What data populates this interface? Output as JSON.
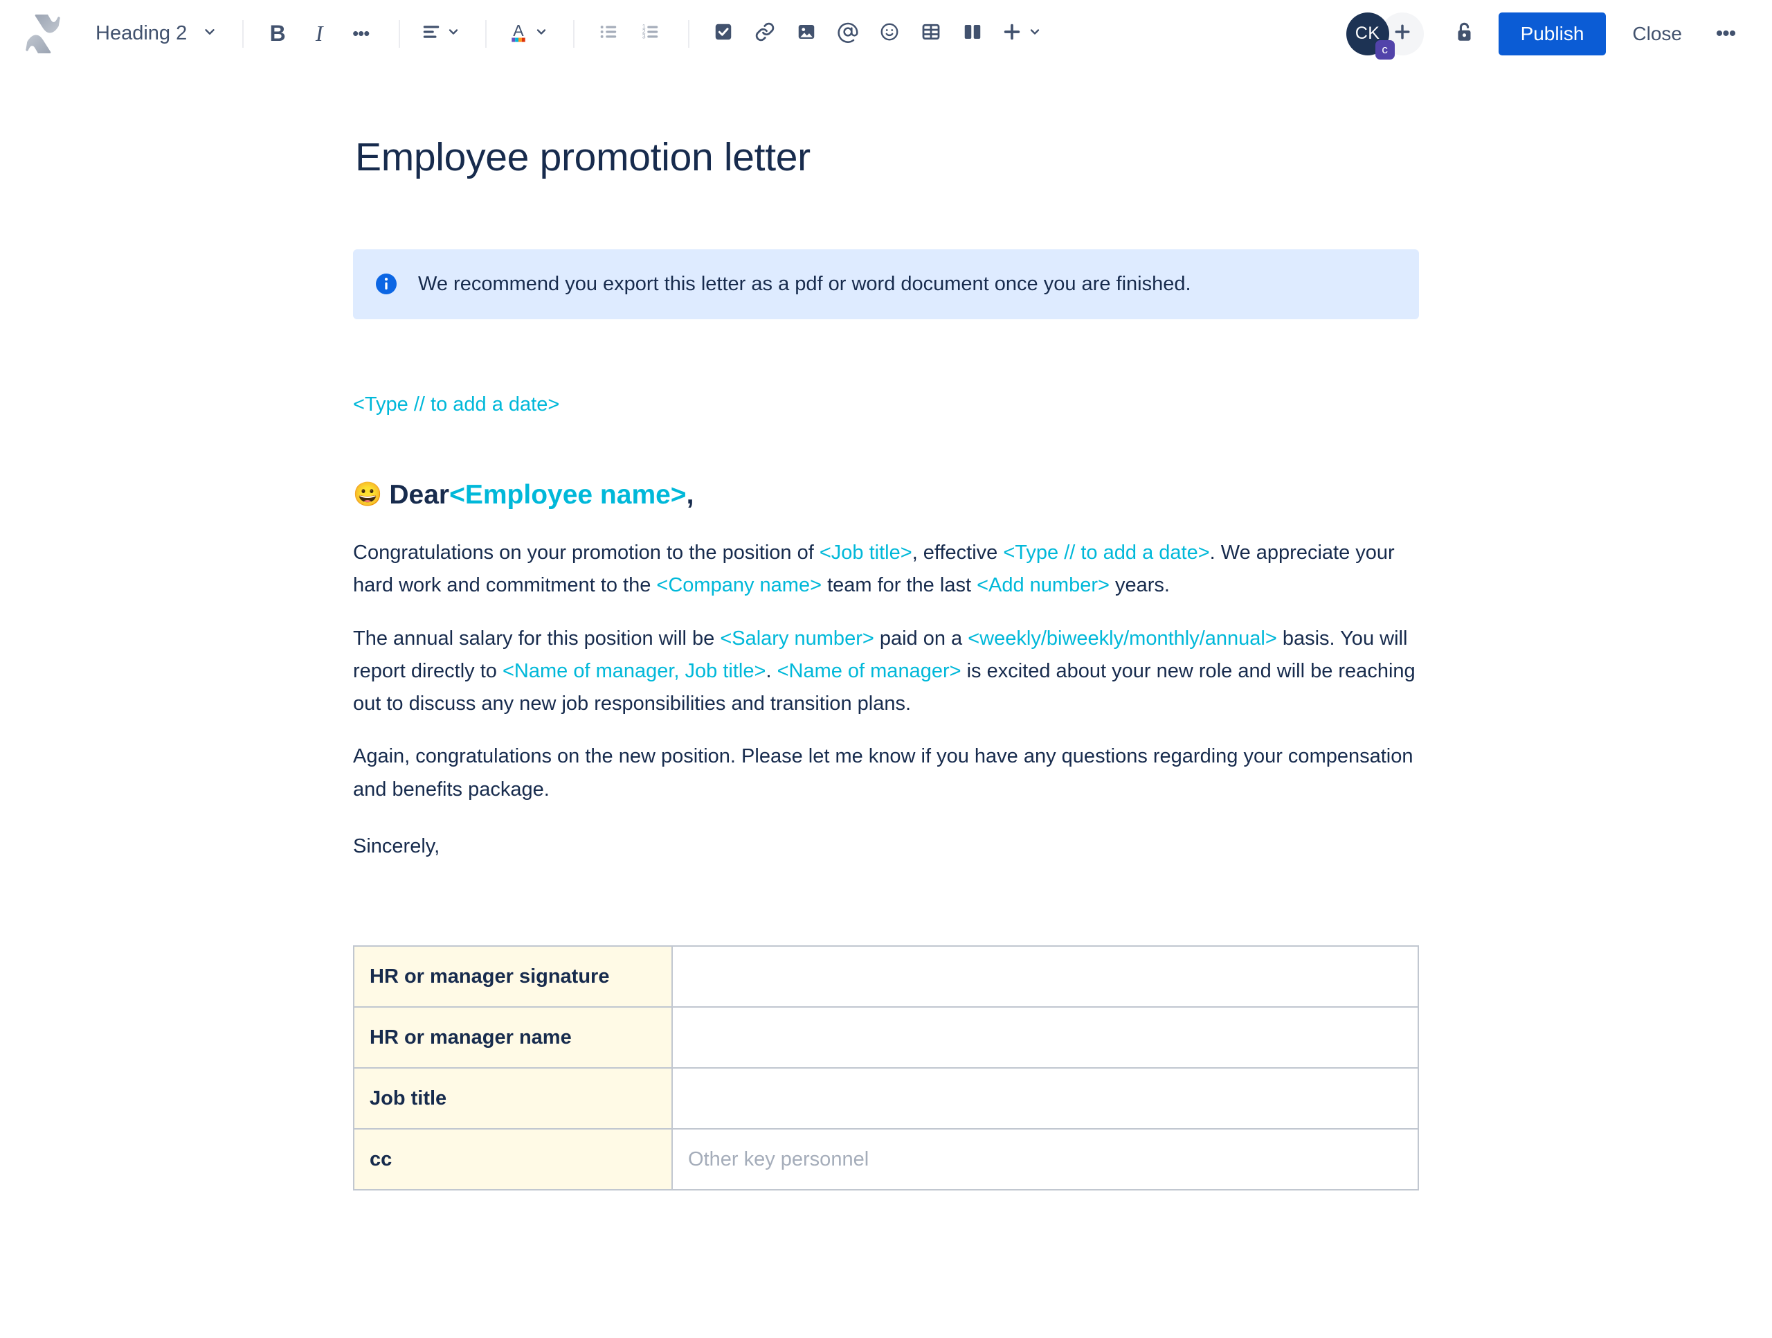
{
  "toolbar": {
    "logo_icon": "confluence-logo-icon",
    "text_style": {
      "label": "Heading 2",
      "chevron": "chevron-down-icon"
    },
    "bold": "B",
    "italic": "I",
    "more_formatting": "•••",
    "align_icon": "text-align-icon",
    "text_color_icon": "text-color-icon",
    "bullet_list_icon": "bullet-list-icon",
    "numbered_list_icon": "numbered-list-icon",
    "task_icon": "task-checkbox-icon",
    "link_icon": "link-icon",
    "image_icon": "image-icon",
    "mention_icon": "mention-at-icon",
    "emoji_icon": "emoji-icon",
    "table_icon": "table-icon",
    "layout_icon": "page-layout-icon",
    "insert_icon": "plus-icon",
    "avatar_initials": "CK",
    "avatar_badge": "c",
    "add_person_icon": "plus-icon",
    "restrictions_icon": "unlocked-padlock-icon",
    "publish_label": "Publish",
    "close_label": "Close",
    "overflow_label": "•••",
    "accent_color": "#0B5CD5",
    "avatar_color": "#1D3354",
    "badge_color": "#5243AA"
  },
  "document": {
    "title": "Employee promotion letter",
    "info_panel": {
      "icon": "info-icon",
      "text": "We recommend you export this letter as a pdf or word document once you are finished.",
      "background": "#DEEBFF"
    },
    "date_placeholder": "<Type // to add a date>",
    "placeholder_color": "#00B8D9",
    "greeting": {
      "emoji": "😀",
      "prefix": "Dear ",
      "placeholder": "<Employee name>",
      "suffix": ","
    },
    "paragraph1": {
      "p1": "Congratulations on your promotion to the position of ",
      "ph1": "<Job title>",
      "p2": ", effective ",
      "ph2": "<Type // to add a date>",
      "p3": ". We appreciate your hard work and commitment to the ",
      "ph3": "<Company name>",
      "p4": " team for the last ",
      "ph4": "<Add number>",
      "p5": " years."
    },
    "paragraph2": {
      "p1": "The annual salary for this position will be ",
      "ph1": "<Salary number>",
      "p2": " paid on a ",
      "ph2": "<weekly/biweekly/monthly/annual>",
      "p3": " basis. You will report directly to ",
      "ph3": "<Name of manager, Job title>",
      "p4": ". ",
      "ph4": "<Name of manager>",
      "p5": " is excited about your new role and will be reaching out to discuss any new job responsibilities and transition plans."
    },
    "paragraph3": "Again, congratulations on the new position. Please let me know if you have any questions regarding your compensation and benefits package.",
    "signoff": "Sincerely,",
    "signature_table": {
      "label_bg": "#FFFAE6",
      "rows": [
        {
          "label": "HR or manager signature",
          "value": "",
          "placeholder": ""
        },
        {
          "label": "HR or manager name",
          "value": "",
          "placeholder": ""
        },
        {
          "label": "Job title",
          "value": "",
          "placeholder": ""
        },
        {
          "label": "cc",
          "value": "",
          "placeholder": "Other key personnel"
        }
      ]
    }
  }
}
